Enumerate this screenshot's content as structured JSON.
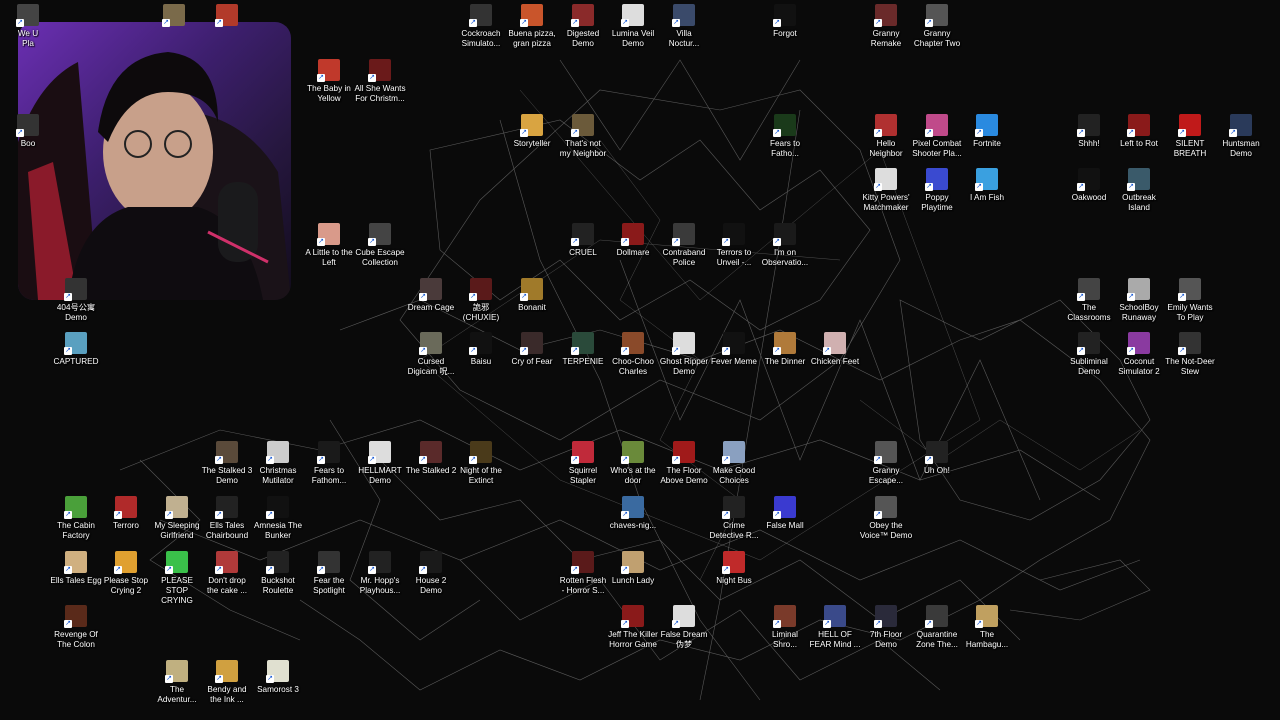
{
  "desktop": {
    "icons": [
      {
        "label": "We U\nPla",
        "color": "#444"
      },
      {
        "label": "",
        "color": "#7a6a4a"
      },
      {
        "label": "",
        "color": "#b23a2a"
      },
      {
        "label": "Cockroach\nSimulato...",
        "color": "#333"
      },
      {
        "label": "Buena pizza,\ngran pizza",
        "color": "#c9552b"
      },
      {
        "label": "Digested\nDemo",
        "color": "#8a2a2a"
      },
      {
        "label": "Lumina Veil\nDemo",
        "color": "#ddd"
      },
      {
        "label": "Villa\nNoctur...",
        "color": "#3a4a6a"
      },
      {
        "label": "Forgot",
        "color": "#111"
      },
      {
        "label": "Granny\nRemake",
        "color": "#6a2a2a"
      },
      {
        "label": "Granny\nChapter Two",
        "color": "#555"
      },
      {
        "label": "The Baby in\nYellow",
        "color": "#c0392b"
      },
      {
        "label": "All She Wants\nFor Christm...",
        "color": "#6a1a1a"
      },
      {
        "label": "Boo",
        "color": "#333"
      },
      {
        "label": "Storyteller",
        "color": "#d9a441"
      },
      {
        "label": "That's not\nmy Neighbor",
        "color": "#6b5a3a"
      },
      {
        "label": "Fears to\nFatho...",
        "color": "#1a3a1a"
      },
      {
        "label": "Hello\nNeighbor",
        "color": "#b03030"
      },
      {
        "label": "Pixel Combat\nShooter Pla...",
        "color": "#c04a8a"
      },
      {
        "label": "Fortnite",
        "color": "#2a8ae0"
      },
      {
        "label": "Shhh!",
        "color": "#222"
      },
      {
        "label": "Left to Rot",
        "color": "#8a1a1a"
      },
      {
        "label": "SILENT\nBREATH",
        "color": "#c01a1a"
      },
      {
        "label": "Huntsman\nDemo",
        "color": "#2a3a5a"
      },
      {
        "label": "Kitty Powers'\nMatchmaker",
        "color": "#ddd"
      },
      {
        "label": "Poppy\nPlaytime",
        "color": "#3a4ad0"
      },
      {
        "label": "I Am Fish",
        "color": "#3aa0e0"
      },
      {
        "label": "Oakwood",
        "color": "#111"
      },
      {
        "label": "Outbreak\nIsland",
        "color": "#3a5a6a"
      },
      {
        "label": "A Little to the\nLeft",
        "color": "#d99a8a"
      },
      {
        "label": "Cube Escape\nCollection",
        "color": "#444"
      },
      {
        "label": "CRUEL",
        "color": "#222"
      },
      {
        "label": "Dollmare",
        "color": "#8a1a1a"
      },
      {
        "label": "Contraband\nPolice",
        "color": "#3a3a3a"
      },
      {
        "label": "Terrors to\nUnveil -...",
        "color": "#111"
      },
      {
        "label": "I'm on\nObservatio...",
        "color": "#1a1a1a"
      },
      {
        "label": "Dream Cage",
        "color": "#4a3a3a"
      },
      {
        "label": "詭邪\n(CHUXIE)",
        "color": "#5a1a1a"
      },
      {
        "label": "Bonanit",
        "color": "#a07a2a"
      },
      {
        "label": "The\nClassrooms",
        "color": "#444"
      },
      {
        "label": "SchoolBoy\nRunaway",
        "color": "#aaa"
      },
      {
        "label": "Emily Wants\nTo Play",
        "color": "#555"
      },
      {
        "label": "404号公寓\nDemo",
        "color": "#333"
      },
      {
        "label": "CAPTURED",
        "color": "#5aa0c0"
      },
      {
        "label": "Cursed\nDigicam 呪...",
        "color": "#6a6a5a"
      },
      {
        "label": "Baisu",
        "color": "#111"
      },
      {
        "label": "Cry of Fear",
        "color": "#3a2a2a"
      },
      {
        "label": "TERPENIE",
        "color": "#2a4a3a"
      },
      {
        "label": "Choo-Choo\nCharles",
        "color": "#8a4a2a"
      },
      {
        "label": "Ghost Ripper\nDemo",
        "color": "#ddd"
      },
      {
        "label": "Fever Meme",
        "color": "#111"
      },
      {
        "label": "The Dinner",
        "color": "#b07a3a"
      },
      {
        "label": "Chicken Feet",
        "color": "#d0b0b0"
      },
      {
        "label": "Subliminal\nDemo",
        "color": "#222"
      },
      {
        "label": "Coconut\nSimulator 2",
        "color": "#8a3aa0"
      },
      {
        "label": "The Not-Deer\nStew",
        "color": "#333"
      },
      {
        "label": "The Stalked 3\nDemo",
        "color": "#5a4a3a"
      },
      {
        "label": "Christmas\nMutilator",
        "color": "#ccc"
      },
      {
        "label": "Fears to\nFathom...",
        "color": "#1a1a1a"
      },
      {
        "label": "HELLMART\nDemo",
        "color": "#ddd"
      },
      {
        "label": "The Stalked 2",
        "color": "#5a2a2a"
      },
      {
        "label": "Night of the\nExtinct",
        "color": "#4a3a1a"
      },
      {
        "label": "Squirrel\nStapler",
        "color": "#c02a3a"
      },
      {
        "label": "Who's at the\ndoor",
        "color": "#6a8a3a"
      },
      {
        "label": "The Floor\nAbove Demo",
        "color": "#a01a1a"
      },
      {
        "label": "Make Good\nChoices",
        "color": "#8aa0c0"
      },
      {
        "label": "Granny\nEscape...",
        "color": "#555"
      },
      {
        "label": "Uh Oh!",
        "color": "#222"
      },
      {
        "label": "The Cabin\nFactory",
        "color": "#4aa03a"
      },
      {
        "label": "Terroro",
        "color": "#b02a2a"
      },
      {
        "label": "My Sleeping\nGirlfriend",
        "color": "#c0b090"
      },
      {
        "label": "Ells Tales\nChairbound",
        "color": "#222"
      },
      {
        "label": "Amnesia The\nBunker",
        "color": "#111"
      },
      {
        "label": "chaves-nig...",
        "color": "#3a6aa0"
      },
      {
        "label": "Crime\nDetective R...",
        "color": "#222"
      },
      {
        "label": "False Mall",
        "color": "#3a3ad0"
      },
      {
        "label": "Obey the\nVoice™ Demo",
        "color": "#555"
      },
      {
        "label": "Ells Tales Egg",
        "color": "#d0b080"
      },
      {
        "label": "Please Stop\nCrying 2",
        "color": "#e0a030"
      },
      {
        "label": "PLEASE STOP\nCRYING",
        "color": "#3ac04a"
      },
      {
        "label": "Don't drop\nthe cake ...",
        "color": "#b03a3a"
      },
      {
        "label": "Buckshot\nRoulette",
        "color": "#222"
      },
      {
        "label": "Fear the\nSpotlight",
        "color": "#333"
      },
      {
        "label": "Mr. Hopp's\nPlayhous...",
        "color": "#222"
      },
      {
        "label": "House 2\nDemo",
        "color": "#1a1a1a"
      },
      {
        "label": "Rotten Flesh\n- Horror S...",
        "color": "#5a1a1a"
      },
      {
        "label": "Lunch Lady",
        "color": "#c0a070"
      },
      {
        "label": "Night Bus",
        "color": "#c02a2a"
      },
      {
        "label": "Revenge Of\nThe Colon",
        "color": "#5a2a1a"
      },
      {
        "label": "Jeff The Killer\nHorror Game",
        "color": "#8a1a1a"
      },
      {
        "label": "False Dream\n伪梦",
        "color": "#ddd"
      },
      {
        "label": "Liminal\nShro...",
        "color": "#7a3a2a"
      },
      {
        "label": "HELL OF\nFEAR Mind ...",
        "color": "#3a4a8a"
      },
      {
        "label": "7th Floor\nDemo",
        "color": "#2a2a3a"
      },
      {
        "label": "Quarantine\nZone The...",
        "color": "#3a3a3a"
      },
      {
        "label": "The\nHambagu...",
        "color": "#c0a060"
      },
      {
        "label": "The\nAdventur...",
        "color": "#c0b080"
      },
      {
        "label": "Bendy and\nthe Ink ...",
        "color": "#d0a040"
      },
      {
        "label": "Samorost 3",
        "color": "#e0e0d0"
      }
    ]
  }
}
